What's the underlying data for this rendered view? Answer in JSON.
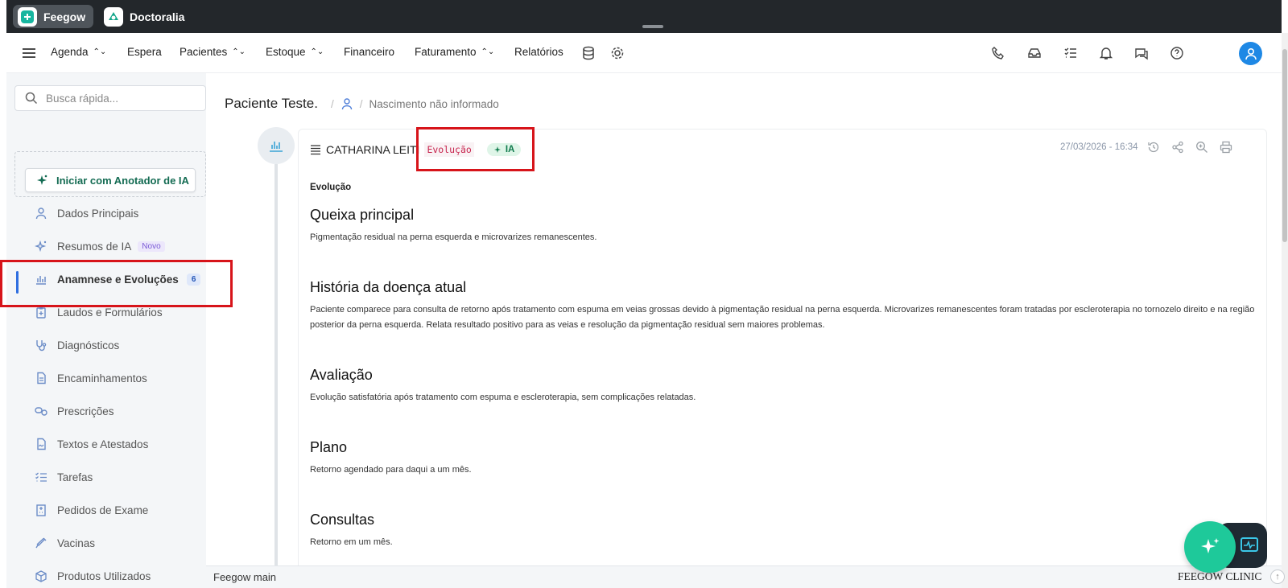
{
  "os_tabs": [
    {
      "label": "Feegow",
      "icon": "feegow-logo-icon"
    },
    {
      "label": "Doctoralia",
      "icon": "doctoralia-logo-icon"
    }
  ],
  "navbar": {
    "menu_icon": "hamburger-menu-icon",
    "items": [
      {
        "label": "Agenda",
        "has_dropdown": true
      },
      {
        "label": "Espera",
        "has_dropdown": false
      },
      {
        "label": "Pacientes",
        "has_dropdown": true
      },
      {
        "label": "Estoque",
        "has_dropdown": true
      },
      {
        "label": "Financeiro",
        "has_dropdown": false
      },
      {
        "label": "Faturamento",
        "has_dropdown": true
      },
      {
        "label": "Relatórios",
        "has_dropdown": false
      }
    ],
    "tool_icons": [
      "database-icon",
      "settings-gear-icon"
    ],
    "right_icons": [
      "phone-icon",
      "inbox-icon",
      "task-list-icon",
      "bell-icon",
      "chat-icon",
      "help-icon"
    ],
    "avatar_color": "#1e88e5"
  },
  "sidebar": {
    "search_placeholder": "Busca rápida...",
    "ai_button_label": "Iniciar com Anotador de IA",
    "items": [
      {
        "label": "Dados Principais",
        "icon": "user-icon"
      },
      {
        "label": "Resumos de IA",
        "icon": "ai-sparkle-icon",
        "badge": "Novo"
      },
      {
        "label": "Anamnese e Evoluções",
        "icon": "bar-chart-icon",
        "count": "6",
        "active": true
      },
      {
        "label": "Laudos e Formulários",
        "icon": "clipboard-icon"
      },
      {
        "label": "Diagnósticos",
        "icon": "stethoscope-icon"
      },
      {
        "label": "Encaminhamentos",
        "icon": "document-icon"
      },
      {
        "label": "Prescrições",
        "icon": "pills-icon"
      },
      {
        "label": "Textos e Atestados",
        "icon": "file-signature-icon"
      },
      {
        "label": "Tarefas",
        "icon": "task-list-icon"
      },
      {
        "label": "Pedidos de Exame",
        "icon": "hospital-icon"
      },
      {
        "label": "Vacinas",
        "icon": "syringe-icon"
      },
      {
        "label": "Produtos Utilizados",
        "icon": "box-icon"
      }
    ]
  },
  "breadcrumb": {
    "patient_name": "Paciente Teste.",
    "birth": "Nascimento não informado"
  },
  "record": {
    "author": "CATHARINA LEITI",
    "type_tag": "Evolução",
    "ia_tag": "IA",
    "datetime": "27/03/2026 - 16:34",
    "actions": [
      "history-icon",
      "share-icon",
      "zoom-icon",
      "print-icon"
    ],
    "form_title": "Evolução",
    "sections": [
      {
        "heading": "Queixa principal",
        "text": "Pigmentação residual na perna esquerda e microvarizes remanescentes."
      },
      {
        "heading": "História da doença atual",
        "text": "Paciente comparece para consulta de retorno após tratamento com espuma em veias grossas devido à pigmentação residual na perna esquerda. Microvarizes remanescentes foram tratadas por escleroterapia no tornozelo direito e na região posterior da perna esquerda. Relata resultado positivo para as veias e resolução da pigmentação residual sem maiores problemas."
      },
      {
        "heading": "Avaliação",
        "text": "Evolução satisfatória após tratamento com espuma e escleroterapia, sem complicações relatadas."
      },
      {
        "heading": "Plano",
        "text": "Retorno agendado para daqui a um mês."
      },
      {
        "heading": "Consultas",
        "text": "Retorno em um mês."
      }
    ]
  },
  "footer": {
    "left": "Feegow main",
    "right": "FEEGOW CLINIC"
  },
  "colors": {
    "highlight": "#d7141a",
    "accent_blue": "#2f6fe0",
    "ai_green": "#1ec99a"
  }
}
